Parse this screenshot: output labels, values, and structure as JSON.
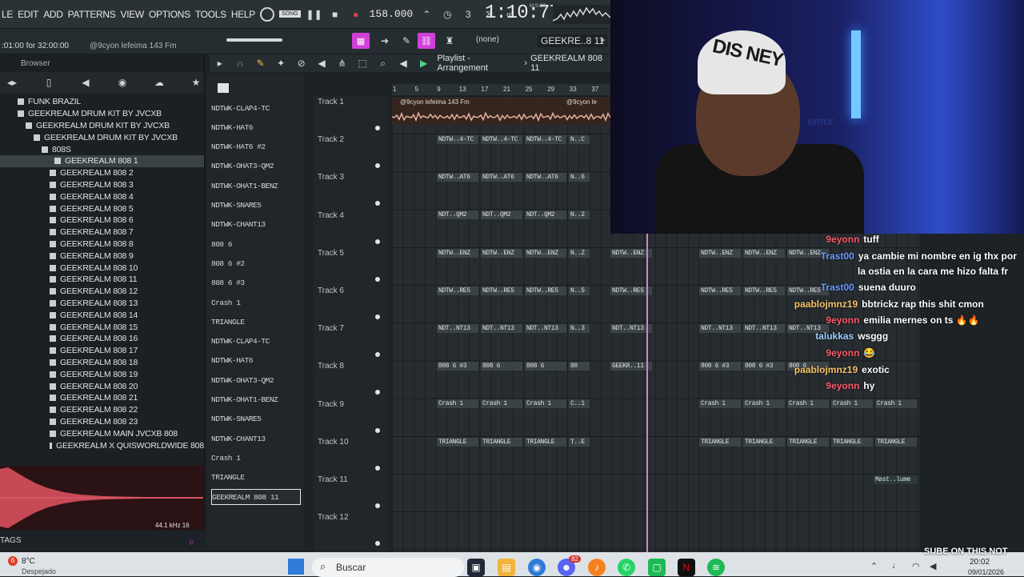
{
  "menu": {
    "items": [
      "LE",
      "EDIT",
      "ADD",
      "PATTERNS",
      "VIEW",
      "OPTIONS",
      "TOOLS",
      "HELP"
    ]
  },
  "transport": {
    "mode": "SONG",
    "tempo": "158.000",
    "clock": "1:10:77",
    "clock_label": "M:S:CS"
  },
  "hint": {
    "text": ":01:00 for 32:00:00",
    "project": "@9cyon lefeima 143 Fm"
  },
  "pattern": {
    "selector": "(none)",
    "current": "GEEKRE..8 11"
  },
  "browser": {
    "title": "Browser",
    "items": [
      {
        "label": "FUNK BRAZIL",
        "indent": 22
      },
      {
        "label": "GEEKREALM DRUM KIT BY JVCXB",
        "indent": 22
      },
      {
        "label": "GEEKREALM DRUM KIT BY JVCXB",
        "indent": 32
      },
      {
        "label": "GEEKREALM DRUM KIT BY JVCXB",
        "indent": 42
      },
      {
        "label": "808S",
        "indent": 52
      },
      {
        "label": "GEEKREALM 808 1",
        "indent": 68,
        "selected": true
      },
      {
        "label": "GEEKREALM 808 2",
        "indent": 62
      },
      {
        "label": "GEEKREALM 808 3",
        "indent": 62
      },
      {
        "label": "GEEKREALM 808 4",
        "indent": 62
      },
      {
        "label": "GEEKREALM 808 5",
        "indent": 62
      },
      {
        "label": "GEEKREALM 808 6",
        "indent": 62
      },
      {
        "label": "GEEKREALM 808 7",
        "indent": 62
      },
      {
        "label": "GEEKREALM 808 8",
        "indent": 62
      },
      {
        "label": "GEEKREALM 808 9",
        "indent": 62
      },
      {
        "label": "GEEKREALM 808 10",
        "indent": 62
      },
      {
        "label": "GEEKREALM 808 11",
        "indent": 62
      },
      {
        "label": "GEEKREALM 808 12",
        "indent": 62
      },
      {
        "label": "GEEKREALM 808 13",
        "indent": 62
      },
      {
        "label": "GEEKREALM 808 14",
        "indent": 62
      },
      {
        "label": "GEEKREALM 808 15",
        "indent": 62
      },
      {
        "label": "GEEKREALM 808 16",
        "indent": 62
      },
      {
        "label": "GEEKREALM 808 17",
        "indent": 62
      },
      {
        "label": "GEEKREALM 808 18",
        "indent": 62
      },
      {
        "label": "GEEKREALM 808 19",
        "indent": 62
      },
      {
        "label": "GEEKREALM 808 20",
        "indent": 62
      },
      {
        "label": "GEEKREALM 808 21",
        "indent": 62
      },
      {
        "label": "GEEKREALM 808 22",
        "indent": 62
      },
      {
        "label": "GEEKREALM 808 23",
        "indent": 62
      },
      {
        "label": "GEEKREALM MAIN JVCXB 808",
        "indent": 62
      },
      {
        "label": "GEEKREALM X QUISWORLDWIDE 808",
        "indent": 62
      }
    ],
    "sample_info": "44.1 kHz 16",
    "tags_label": "TAGS"
  },
  "channel_rack": [
    "NDTWK-CLAP4-TC",
    "NDTWK-HAT6",
    "NDTWK-HAT6 #2",
    "NDTWK-OHAT3-QM2",
    "NDTWK-OHAT1-BENZ",
    "NDTWK-SNARE5",
    "NDTWK-CHANT13",
    "808 6",
    "808 6 #2",
    "808 6 #3",
    "Crash 1",
    "TRIANGLE",
    "NDTWK-CLAP4-TC",
    "NDTWK-HAT6",
    "NDTWK-OHAT3-QM2",
    "NDTWK-OHAT1-BENZ",
    "NDTWK-SNARE5",
    "NDTWK-CHANT13",
    "Crash 1",
    "TRIANGLE",
    "GEEKREALM 808 11"
  ],
  "playlist": {
    "title": "Playlist - Arrangement",
    "pattern": "GEEKREALM 808 11",
    "ruler": [
      "1",
      "5",
      "9",
      "13",
      "17",
      "21",
      "25",
      "29",
      "33",
      "37"
    ],
    "audio_clip_label": "@9cyon lefeima 143 Fm",
    "audio_clip_label2": "@9cyon le",
    "tracks": [
      "Track 1",
      "Track 2",
      "Track 3",
      "Track 4",
      "Track 5",
      "Track 6",
      "Track 7",
      "Track 8",
      "Track 9",
      "Track 10",
      "Track 11",
      "Track 12"
    ],
    "clip_rows": [
      {
        "track": 1,
        "labels": [
          "NDTW..4-TC",
          "NDTW..4-TC",
          "NDTW..4-TC",
          "N..C"
        ]
      },
      {
        "track": 2,
        "labels": [
          "NDTW..AT6",
          "NDTW..AT6",
          "NDTW..AT6",
          "N..6"
        ]
      },
      {
        "track": 3,
        "labels": [
          "NDT..QM2",
          "NDT..QM2",
          "NDT..QM2",
          "N..2"
        ]
      },
      {
        "track": 4,
        "labels": [
          "NDTW..ENZ",
          "NDTW..ENZ",
          "NDTW..ENZ",
          "N..Z",
          "NDTW..ENZ",
          "NDTW..ENZ",
          "NDTW..ENZ",
          "NDTW..ENZ"
        ]
      },
      {
        "track": 5,
        "labels": [
          "NDTW..RE5",
          "NDTW..RE5",
          "NDTW..RE5",
          "N..5",
          "NDTW..RE5",
          "NDTW..RE5",
          "NDTW..RE5",
          "NDTW..RE5"
        ]
      },
      {
        "track": 6,
        "labels": [
          "NDT..NT13",
          "NDT..NT13",
          "NDT..NT13",
          "N..3",
          "NDT..NT13",
          "NDT..NT13",
          "NDT..NT13",
          "NDT..NT13"
        ]
      },
      {
        "track": 7,
        "labels": [
          "808 6 #3",
          "808 6",
          "808 6",
          "80",
          "GEEKR..11",
          "808 6 #3",
          "808 6 #3",
          "808 6"
        ]
      },
      {
        "track": 8,
        "labels": [
          "Crash 1",
          "Crash 1",
          "Crash 1",
          "C..1",
          "Crash 1",
          "Crash 1",
          "Crash 1",
          "Crash 1",
          "Crash 1",
          "Crash 1"
        ]
      },
      {
        "track": 9,
        "labels": [
          "TRIANGLE",
          "TRIANGLE",
          "TRIANGLE",
          "T..E",
          "TRIANGLE",
          "TRIANGLE",
          "TRIANGLE",
          "TRIANGLE",
          "TRIANGLE",
          "TRIANGLE"
        ]
      }
    ],
    "automation_label": "Mast..lume"
  },
  "webcam": {
    "beanie_text": "DIS NEY",
    "wall_text": "emor"
  },
  "chat": [
    {
      "user": "9eyonn",
      "text": "tuff",
      "color": "#ff5a6a"
    },
    {
      "user": "Trast00",
      "text": "ya cambie mi nombre en ig thx por",
      "color": "#6e9cff"
    },
    {
      "user": "",
      "text": "la ostia en la cara me hizo falta fr",
      "color": "#ffffff"
    },
    {
      "user": "Trast00",
      "text": "suena duuro",
      "color": "#6e9cff"
    },
    {
      "user": "paablojmnz19",
      "text": "bbtrickz rap this shit cmon",
      "color": "#f5c46a"
    },
    {
      "user": "9eyonn",
      "text": "emilia mernes on ts 🔥🔥",
      "color": "#ff5a6a"
    },
    {
      "user": "talukkas",
      "text": "wsggg",
      "color": "#9fd0ff"
    },
    {
      "user": "9eyonn",
      "text": "😂",
      "color": "#ff5a6a"
    },
    {
      "user": "paablojmnz19",
      "text": "exotic",
      "color": "#f5c46a"
    },
    {
      "user": "9eyonn",
      "text": "hy",
      "color": "#ff5a6a"
    }
  ],
  "taskbar": {
    "weather_temp": "8°C",
    "weather_desc": "Despejado",
    "weather_badge": "6",
    "search_placeholder": "Buscar",
    "time": "20:02",
    "date": "09/01/2026",
    "discord_badge": "82"
  },
  "watermark": "SUBE ON THIS NOT"
}
